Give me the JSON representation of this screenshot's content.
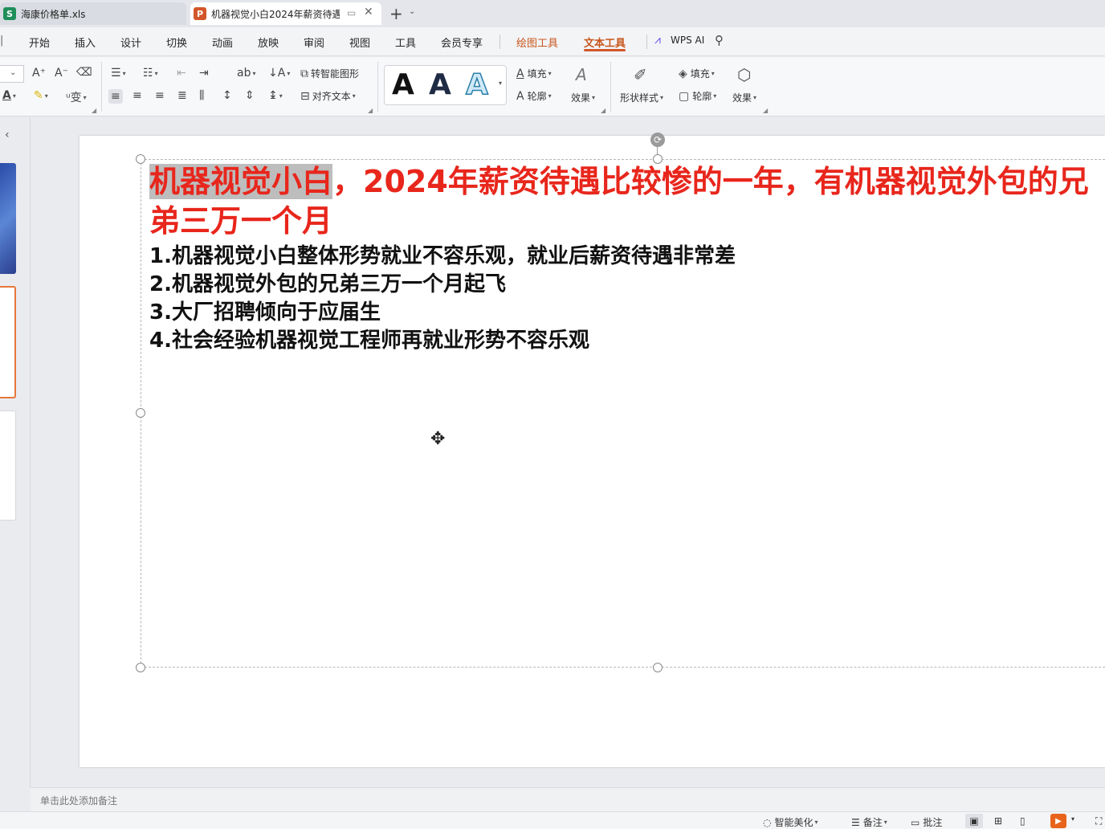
{
  "tabs": [
    {
      "badge": "S",
      "badge_color": "#1f8f5a",
      "label": "海康价格单.xls"
    },
    {
      "badge": "P",
      "badge_color": "#d2562a",
      "label": "机器视觉小白2024年薪资待遇"
    }
  ],
  "menu": {
    "items": [
      "开始",
      "插入",
      "设计",
      "切换",
      "动画",
      "放映",
      "审阅",
      "视图",
      "工具",
      "会员专享"
    ],
    "tools": [
      "绘图工具",
      "文本工具"
    ],
    "ai_label": "WPS AI"
  },
  "ribbon": {
    "smart_shape": "转智能图形",
    "align_text": "对齐文本",
    "fill": "填充",
    "outline": "轮廓",
    "effect": "效果",
    "shape_style": "形状样式",
    "fill2": "填充",
    "outline2": "轮廓",
    "effect2": "效果",
    "big_a": "A"
  },
  "slide": {
    "title_highlight": "机器视觉小白",
    "title_rest": "，2024年薪资待遇比较惨的一年，有机器视觉外包的兄",
    "title_line2": "弟三万一个月",
    "bullets": [
      "1.机器视觉小白整体形势就业不容乐观，就业后薪资待遇非常差",
      "2.机器视觉外包的兄弟三万一个月起飞",
      "3.大厂招聘倾向于应届生",
      "4.社会经验机器视觉工程师再就业形势不容乐观"
    ]
  },
  "notes_placeholder": "单击此处添加备注",
  "status": {
    "beautify": "智能美化",
    "notes": "备注",
    "comment": "批注"
  },
  "colors": {
    "accent": "#d2562a",
    "title_red": "#e8261c"
  }
}
